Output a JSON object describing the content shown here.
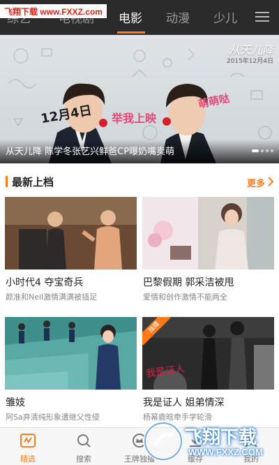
{
  "watermark_top": "飞翔下载 www.FXXZ.com",
  "tabs": [
    {
      "label": "综艺"
    },
    {
      "label": "电视剧"
    },
    {
      "label": "电影"
    },
    {
      "label": "动漫"
    },
    {
      "label": "少儿"
    }
  ],
  "active_tab": "电影",
  "hero": {
    "caption": "从天儿降 陈学冬张艺兴鲜爸CP曝奶嘴卖萌",
    "logo": "从天儿降",
    "date": "2015年12月4日",
    "slogan_date": "12月4日",
    "slogan_mid": "举我上映",
    "slogan_right": "萌萌哒"
  },
  "section": {
    "title": "最新上档",
    "more": "更多"
  },
  "cards": [
    {
      "title": "小时代4 夺宝奇兵",
      "desc": "颜准和Neil激情满满被插足"
    },
    {
      "title": "巴黎假期 郭采洁被甩",
      "desc": "爱情和创作激情不能两全"
    },
    {
      "title": "雏妓",
      "desc": "阿Sa弃清纯形象遭继父性侵",
      "badge": ""
    },
    {
      "title": "我是证人 姐弟情深",
      "desc": "杨幂鹿晗牵手学轮滑",
      "badge": "独播"
    }
  ],
  "bottom_nav": [
    {
      "label": "精选",
      "icon": "featured-icon"
    },
    {
      "label": "搜索",
      "icon": "search-icon"
    },
    {
      "label": "王牌独播",
      "icon": "crown-icon"
    },
    {
      "label": "缓存",
      "icon": "download-icon"
    },
    {
      "label": "我的",
      "icon": "user-icon"
    }
  ],
  "active_nav": "精选",
  "watermark_bottom": {
    "text": "飞翔下载",
    "url": "WWW.FXXZ.COM"
  },
  "colors": {
    "accent": "#ff7a1a",
    "topbar": "#2b2b2b"
  }
}
